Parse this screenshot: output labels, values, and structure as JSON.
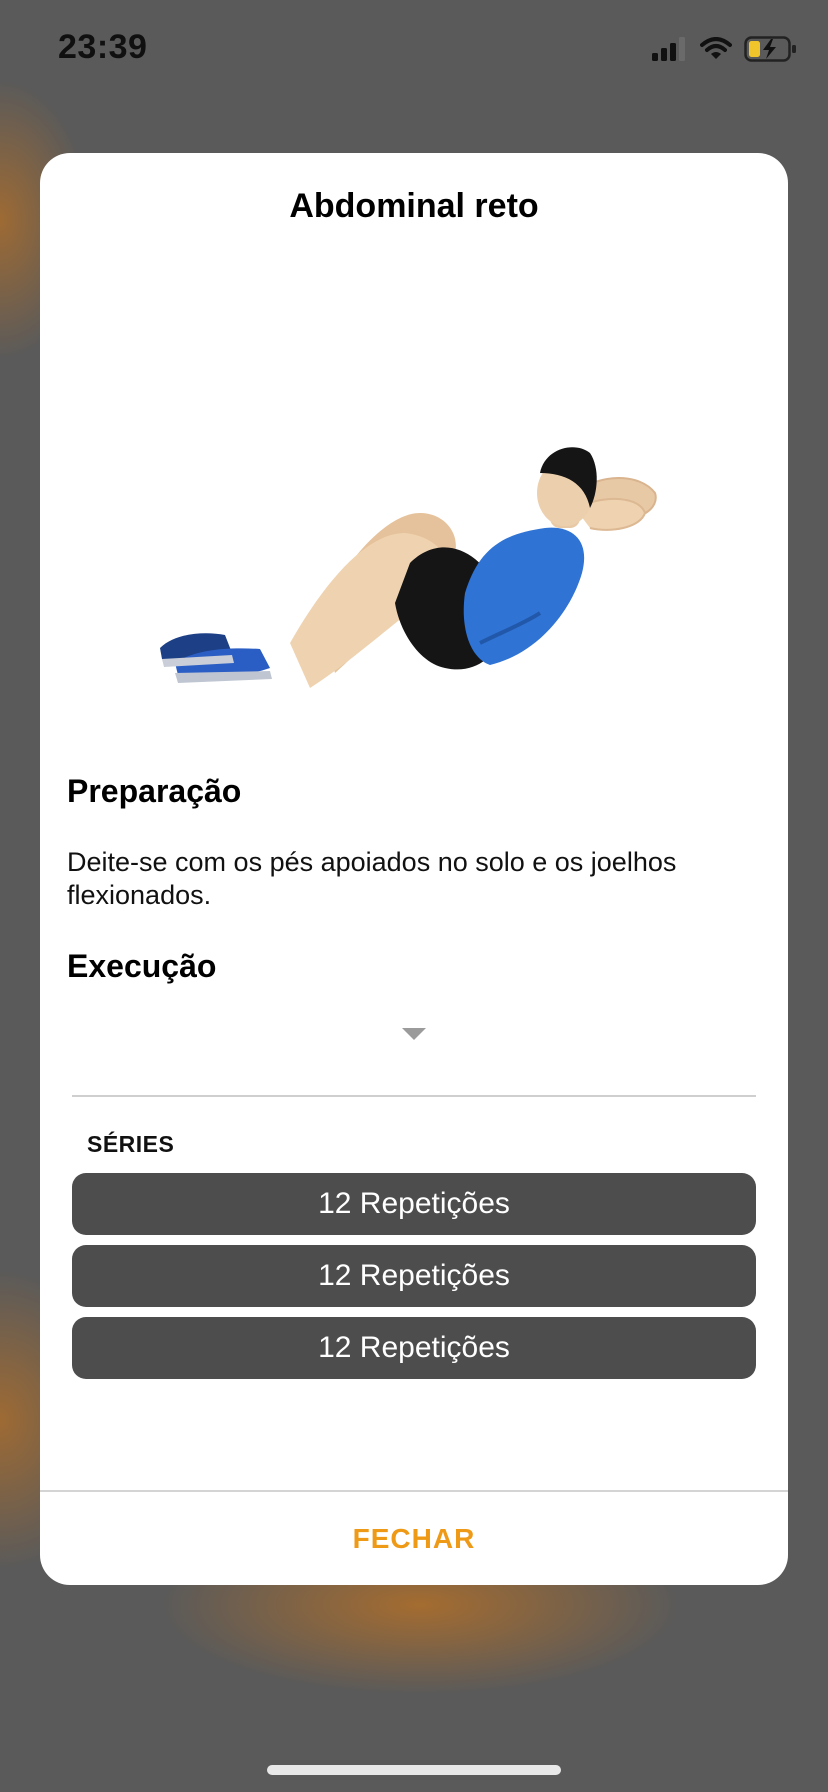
{
  "status_bar": {
    "time": "23:39",
    "icons": [
      "signal-icon",
      "wifi-icon",
      "battery-charging-icon"
    ],
    "battery_color": "#f2c42b"
  },
  "modal": {
    "title": "Abdominal reto",
    "illustration": "crunch-exercise-figure",
    "preparation": {
      "heading": "Preparação",
      "text": "Deite-se com os pés apoiados no solo e os joelhos flexionados."
    },
    "execution": {
      "heading": "Execução",
      "expand_icon": "chevron-down-icon"
    },
    "series": {
      "label": "SÉRIES",
      "items": [
        "12 Repetições",
        "12 Repetições",
        "12 Repetições"
      ]
    },
    "close_label": "FECHAR",
    "accent_color": "#ef9a17"
  }
}
